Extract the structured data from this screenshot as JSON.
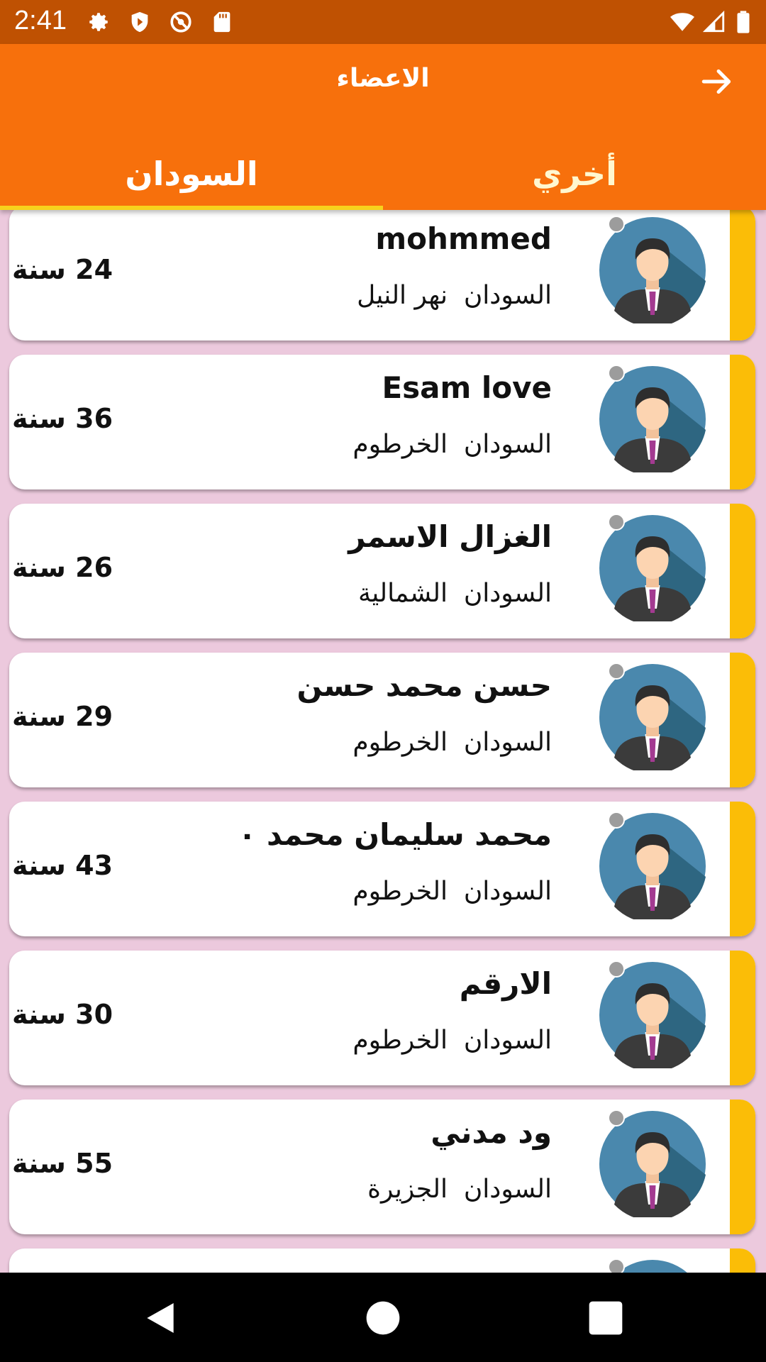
{
  "status_bar": {
    "time": "2:41"
  },
  "header": {
    "title": "الاعضاء"
  },
  "tabs": [
    {
      "label": "السودان",
      "selected": true
    },
    {
      "label": "أخري",
      "selected": false
    }
  ],
  "members": [
    {
      "name": "mohmmed",
      "location": "السودان  نهر النيل",
      "age": "24 سنة"
    },
    {
      "name": "Esam love",
      "location": "السودان  الخرطوم",
      "age": "36 سنة"
    },
    {
      "name": "الغزال الاسمر",
      "location": "السودان  الشمالية",
      "age": "26 سنة"
    },
    {
      "name": "حسن محمد حسن",
      "location": "السودان  الخرطوم",
      "age": "29 سنة"
    },
    {
      "name": "محمد سليمان محمد ٠",
      "location": "السودان  الخرطوم",
      "age": "43 سنة"
    },
    {
      "name": "الارقم",
      "location": "السودان  الخرطوم",
      "age": "30 سنة"
    },
    {
      "name": "ود مدني",
      "location": "السودان  الجزيرة",
      "age": "55 سنة"
    }
  ],
  "colors": {
    "appbar": "#f7700c",
    "statusbar": "#bf5102",
    "stripe": "#fbbd07",
    "background": "#ecc9dd",
    "indicator": "#f7d21c"
  }
}
